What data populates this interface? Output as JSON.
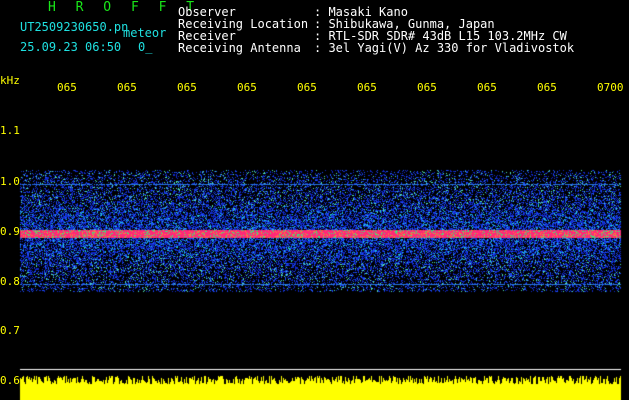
{
  "header": {
    "station": "H R O F F T",
    "filename": "UT2509230650.pn",
    "meteor_label": "meteor",
    "datetime": "25.09.23 06:50",
    "count": "0_"
  },
  "meta": [
    {
      "label": "Observer",
      "sep": ": ",
      "value": "Masaki Kano"
    },
    {
      "label": "Receiving Location",
      "sep": ": ",
      "value": "Shibukawa, Gunma, Japan"
    },
    {
      "label": "Receiver",
      "sep": ": ",
      "value": "RTL-SDR SDR# 43dB L15 103.2MHz CW"
    },
    {
      "label": "Receiving Antenna",
      "sep": ": ",
      "value": "3el Yagi(V) Az 330 for Vladivostok"
    }
  ],
  "y_axis": {
    "unit": "kHz",
    "ticks": [
      "1.1",
      "1.0",
      "0.9",
      "0.8",
      "0.7",
      "0.6"
    ]
  },
  "x_axis": {
    "ticks": [
      "065",
      "065",
      "065",
      "065",
      "065",
      "065",
      "065",
      "065",
      "065",
      "0700"
    ]
  },
  "colors": {
    "axis_text": "#ffff00",
    "station_text": "#19e619",
    "filename_text": "#1fe0e0",
    "background": "#000000",
    "band_pink": "#ff2a7a",
    "noise_blue": "#1030ff",
    "noise_cyan": "#20d0e0"
  }
}
